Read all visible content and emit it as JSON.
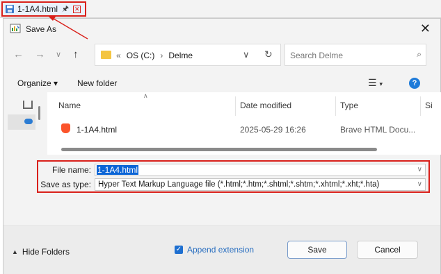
{
  "tab": {
    "label": "1-1A4.html"
  },
  "dialog": {
    "title": "Save As",
    "address": {
      "root_crumb": "OS (C:)",
      "folder_crumb": "Delme"
    },
    "search": {
      "placeholder": "Search Delme"
    },
    "commands": {
      "organize": "Organize",
      "new_folder": "New folder"
    },
    "columns": {
      "name": "Name",
      "date_modified": "Date modified",
      "type": "Type",
      "size_truncated": "Si"
    },
    "files": [
      {
        "name": "1-1A4.html",
        "date": "2025-05-29 16:26",
        "type": "Brave HTML Docu..."
      }
    ],
    "fields": {
      "file_name_label": "File name:",
      "file_name_value": "1-1A4.html",
      "save_as_type_label": "Save as type:",
      "save_as_type_value": "Hyper Text Markup Language file (*.html;*.htm;*.shtml;*.shtm;*.xhtml;*.xht;*.hta)"
    },
    "footer": {
      "hide_folders": "Hide Folders",
      "append_extension": "Append extension",
      "append_extension_checked": true,
      "save": "Save",
      "cancel": "Cancel"
    }
  },
  "colors": {
    "annotation_red": "#d9201a",
    "selection_blue": "#0a64d6",
    "accent_blue": "#1e6fd0",
    "brave_orange": "#fb542b",
    "folder_yellow": "#f4c542"
  },
  "icons": [
    "save-floppy-icon",
    "pin-icon",
    "close-tab-icon",
    "app-icon",
    "back-arrow-icon",
    "forward-arrow-icon",
    "history-chevron-icon",
    "up-arrow-icon",
    "folder-icon",
    "refresh-icon",
    "search-icon",
    "view-list-icon",
    "help-icon",
    "home-icon",
    "onedrive-cloud-icon",
    "brave-html-icon",
    "checkbox-checked-icon",
    "caret-up-icon"
  ]
}
